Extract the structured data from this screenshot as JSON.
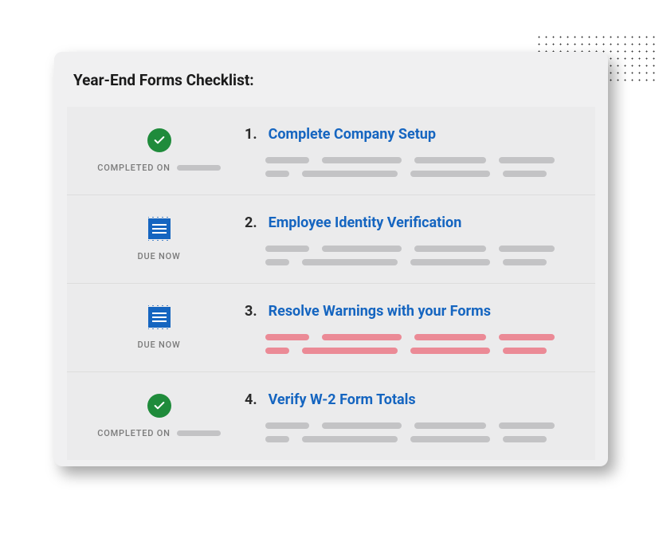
{
  "card": {
    "title": "Year-End Forms Checklist:"
  },
  "items": [
    {
      "status_type": "completed",
      "status_label": "COMPLETED ON",
      "number": "1.",
      "title": "Complete Company Setup",
      "desc_color": "grey"
    },
    {
      "status_type": "due",
      "status_label": "DUE NOW",
      "number": "2.",
      "title": "Employee Identity Verification",
      "desc_color": "grey"
    },
    {
      "status_type": "due",
      "status_label": "DUE NOW",
      "number": "3.",
      "title": "Resolve Warnings with your Forms",
      "desc_color": "pink"
    },
    {
      "status_type": "completed",
      "status_label": "COMPLETED ON",
      "number": "4.",
      "title": "Verify W-2 Form Totals",
      "desc_color": "grey"
    }
  ]
}
